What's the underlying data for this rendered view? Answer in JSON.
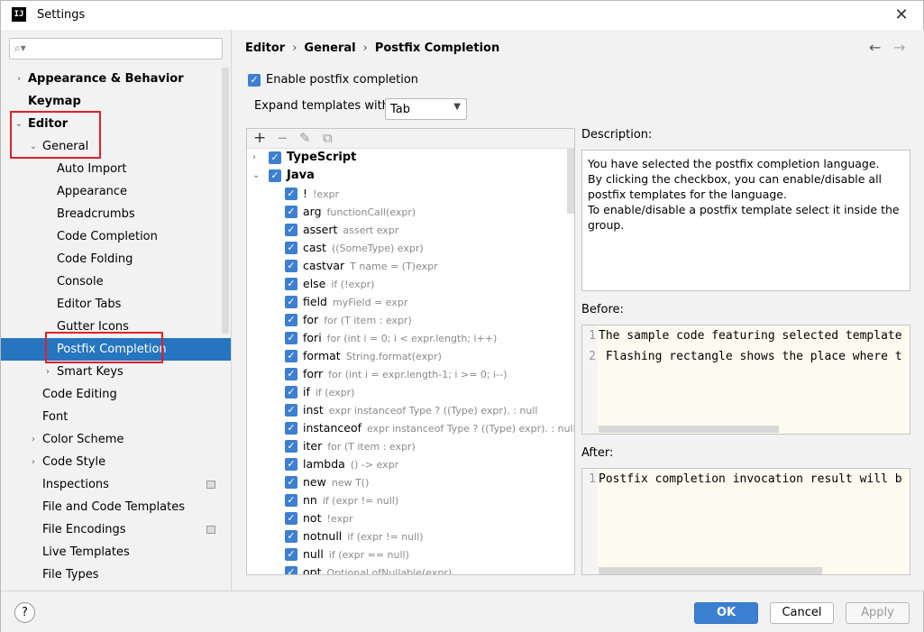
{
  "window": {
    "title": "Settings",
    "app_icon": "IJ"
  },
  "search": {
    "placeholder": ""
  },
  "tree": [
    {
      "label": "Appearance & Behavior",
      "level": 0,
      "arrow": "›",
      "bold": true
    },
    {
      "label": "Keymap",
      "level": 0,
      "arrow": "",
      "bold": true
    },
    {
      "label": "Editor",
      "level": 0,
      "arrow": "⌄",
      "bold": true
    },
    {
      "label": "General",
      "level": 1,
      "arrow": "⌄",
      "bold": false
    },
    {
      "label": "Auto Import",
      "level": 2,
      "arrow": "",
      "bold": false
    },
    {
      "label": "Appearance",
      "level": 2,
      "arrow": "",
      "bold": false
    },
    {
      "label": "Breadcrumbs",
      "level": 2,
      "arrow": "",
      "bold": false
    },
    {
      "label": "Code Completion",
      "level": 2,
      "arrow": "",
      "bold": false
    },
    {
      "label": "Code Folding",
      "level": 2,
      "arrow": "",
      "bold": false
    },
    {
      "label": "Console",
      "level": 2,
      "arrow": "",
      "bold": false
    },
    {
      "label": "Editor Tabs",
      "level": 2,
      "arrow": "",
      "bold": false
    },
    {
      "label": "Gutter Icons",
      "level": 2,
      "arrow": "",
      "bold": false
    },
    {
      "label": "Postfix Completion",
      "level": 2,
      "arrow": "",
      "bold": false,
      "selected": true
    },
    {
      "label": "Smart Keys",
      "level": 2,
      "arrow": "›",
      "bold": false
    },
    {
      "label": "Code Editing",
      "level": 1,
      "arrow": "",
      "bold": false
    },
    {
      "label": "Font",
      "level": 1,
      "arrow": "",
      "bold": false
    },
    {
      "label": "Color Scheme",
      "level": 1,
      "arrow": "›",
      "bold": false
    },
    {
      "label": "Code Style",
      "level": 1,
      "arrow": "›",
      "bold": false
    },
    {
      "label": "Inspections",
      "level": 1,
      "arrow": "",
      "bold": false,
      "project_icon": true
    },
    {
      "label": "File and Code Templates",
      "level": 1,
      "arrow": "",
      "bold": false
    },
    {
      "label": "File Encodings",
      "level": 1,
      "arrow": "",
      "bold": false,
      "project_icon": true
    },
    {
      "label": "Live Templates",
      "level": 1,
      "arrow": "",
      "bold": false
    },
    {
      "label": "File Types",
      "level": 1,
      "arrow": "",
      "bold": false
    }
  ],
  "breadcrumb": {
    "items": [
      "Editor",
      "General",
      "Postfix Completion"
    ],
    "separator": "›"
  },
  "nav": {
    "back": "←",
    "forward": "→"
  },
  "enable": {
    "label": "Enable postfix completion",
    "checked": true
  },
  "expand": {
    "label": "Expand templates with",
    "value": "Tab"
  },
  "toolbar": {
    "add": "+",
    "remove": "−",
    "edit": "✎",
    "copy": "⧉"
  },
  "templates": [
    {
      "key": "TypeScript",
      "example": "",
      "group": true,
      "arrow": "›"
    },
    {
      "key": "Java",
      "example": "",
      "group": true,
      "arrow": "⌄"
    },
    {
      "key": "!",
      "example": "!expr"
    },
    {
      "key": "arg",
      "example": "functionCall(expr)"
    },
    {
      "key": "assert",
      "example": "assert expr"
    },
    {
      "key": "cast",
      "example": "((SomeType) expr)"
    },
    {
      "key": "castvar",
      "example": "T name = (T)expr"
    },
    {
      "key": "else",
      "example": "if (!expr)"
    },
    {
      "key": "field",
      "example": "myField = expr"
    },
    {
      "key": "for",
      "example": "for (T item : expr)"
    },
    {
      "key": "fori",
      "example": "for (int i = 0; i < expr.length; i++)"
    },
    {
      "key": "format",
      "example": "String.format(expr)"
    },
    {
      "key": "forr",
      "example": "for (int i = expr.length-1; i >= 0; i--)"
    },
    {
      "key": "if",
      "example": "if (expr)"
    },
    {
      "key": "inst",
      "example": "expr instanceof Type ? ((Type) expr). : null"
    },
    {
      "key": "instanceof",
      "example": "expr instanceof Type ? ((Type) expr). : null"
    },
    {
      "key": "iter",
      "example": "for (T item : expr)"
    },
    {
      "key": "lambda",
      "example": "() -> expr"
    },
    {
      "key": "new",
      "example": "new T()"
    },
    {
      "key": "nn",
      "example": "if (expr != null)"
    },
    {
      "key": "not",
      "example": "!expr"
    },
    {
      "key": "notnull",
      "example": "if (expr != null)"
    },
    {
      "key": "null",
      "example": "if (expr == null)"
    },
    {
      "key": "opt",
      "example": "Optional.ofNullable(expr)"
    }
  ],
  "description": {
    "label": "Description:",
    "lines": [
      "You have selected the postfix completion language.",
      "By clicking the checkbox, you can enable/disable all postfix templates for the language.",
      "To enable/disable a postfix template select it inside the group."
    ]
  },
  "before": {
    "label": "Before:",
    "lines": [
      {
        "n": "1",
        "text": "The sample code featuring selected template"
      },
      {
        "n": "2",
        "text": " Flashing rectangle shows the place where t"
      }
    ]
  },
  "after": {
    "label": "After:",
    "lines": [
      {
        "n": "1",
        "text": "Postfix completion invocation result will b"
      }
    ]
  },
  "footer": {
    "help": "?",
    "ok": "OK",
    "cancel": "Cancel",
    "apply": "Apply"
  },
  "colors": {
    "accent": "#2675bf",
    "checkbox": "#3d7fd1",
    "highlight": "#e0202a"
  }
}
